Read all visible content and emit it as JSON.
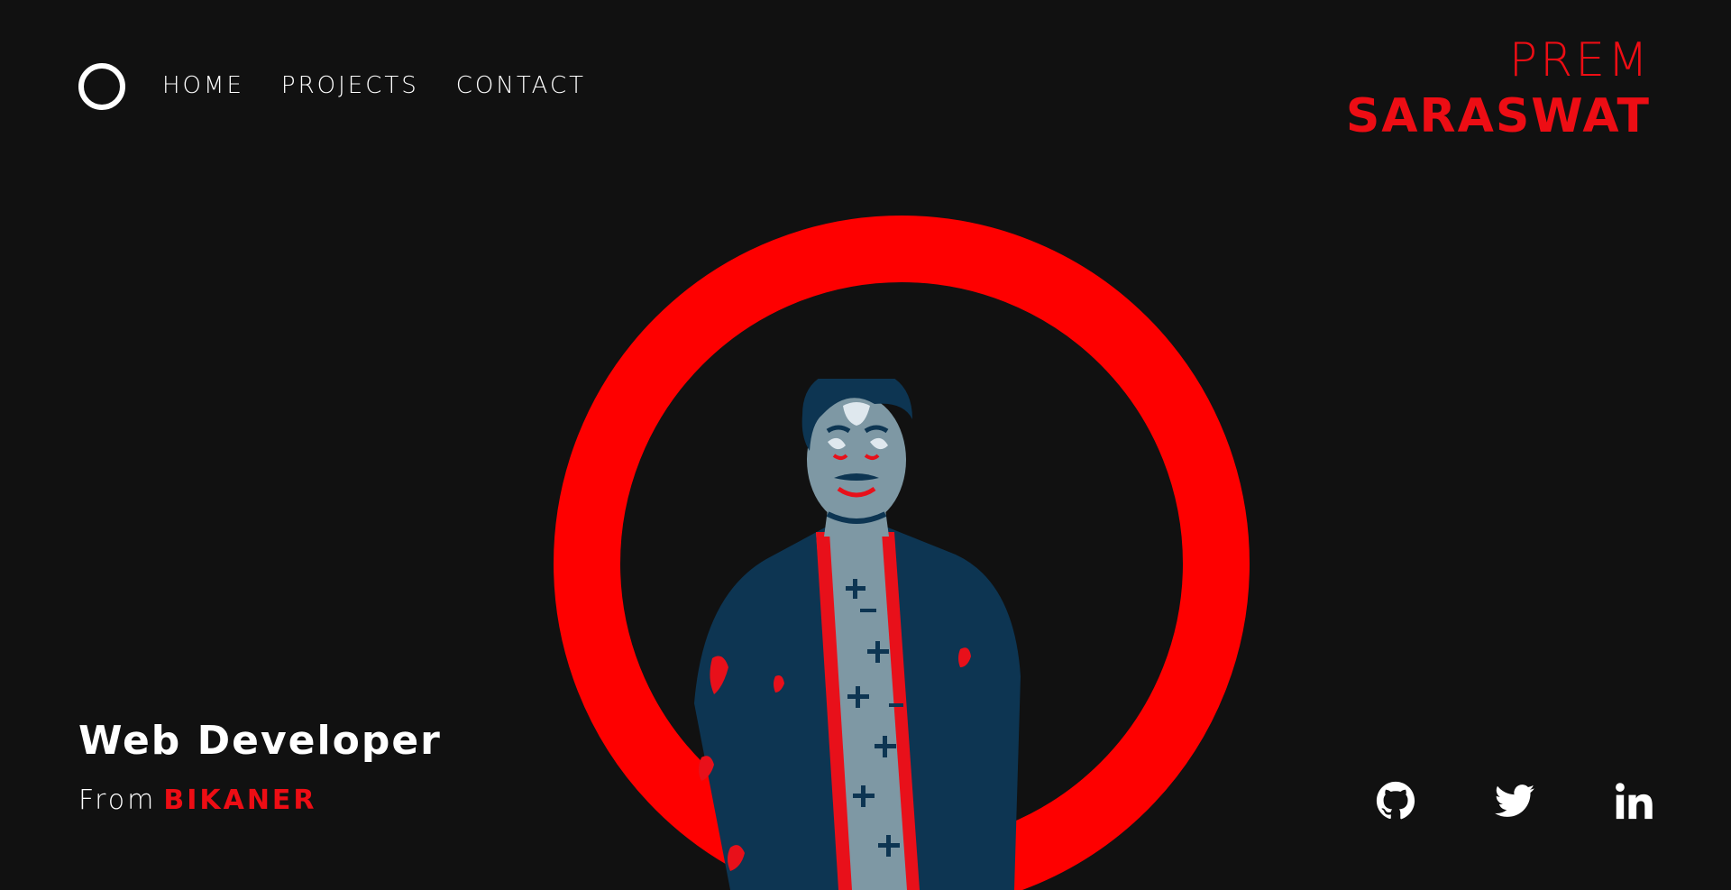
{
  "nav": {
    "items": [
      {
        "label": "HOME"
      },
      {
        "label": "PROJECTS"
      },
      {
        "label": "CONTACT"
      }
    ]
  },
  "brand": {
    "first_name": "PREM",
    "last_name": "SARASWAT"
  },
  "hero": {
    "role": "Web Developer",
    "from_label": "From",
    "city": "BIKANER"
  },
  "socials": [
    {
      "icon": "github-icon"
    },
    {
      "icon": "twitter-icon"
    },
    {
      "icon": "linkedin-icon"
    }
  ],
  "colors": {
    "background": "#111111",
    "accent": "#ed0d14",
    "ring": "#fe0000",
    "text": "#ffffff",
    "portrait_navy": "#0d3552",
    "portrait_gray": "#7e98a4"
  }
}
